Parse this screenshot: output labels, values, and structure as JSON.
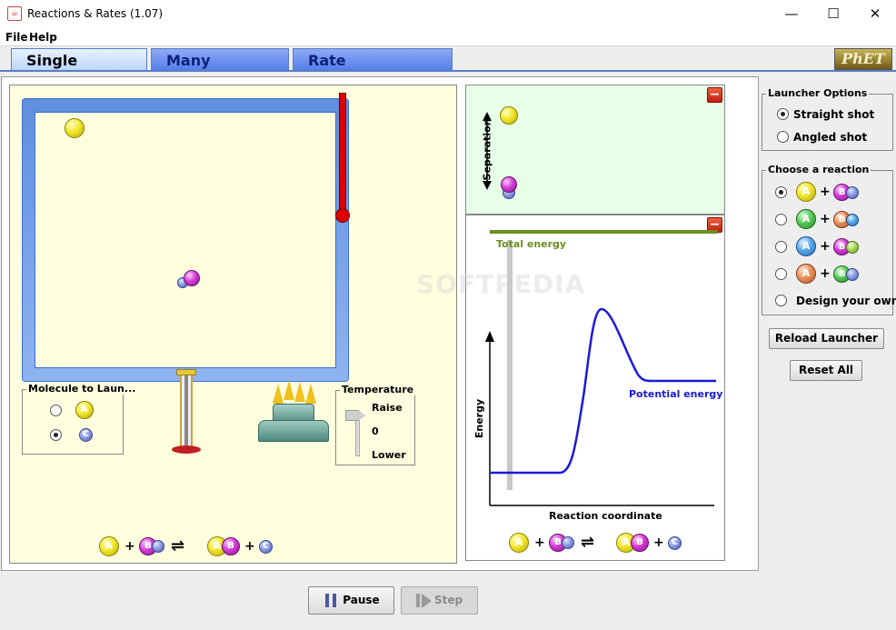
{
  "window": {
    "title": "Reactions & Rates (1.07)",
    "icon": "java-icon"
  },
  "menu": {
    "file": "File",
    "help": "Help"
  },
  "tabs": [
    {
      "label": "Single Collision",
      "active": true
    },
    {
      "label": "Many Collisions",
      "active": false
    },
    {
      "label": "Rate Experiments",
      "active": false
    }
  ],
  "logo": "PhET",
  "watermark": "SOFTPEDIA",
  "launcher_molecule": {
    "title": "Molecule to Laun...",
    "options": [
      {
        "letter": "A",
        "selected": false
      },
      {
        "letter": "C",
        "selected": true
      }
    ]
  },
  "temperature": {
    "title": "Temperature",
    "raise": "Raise",
    "zero": "0",
    "lower": "Lower"
  },
  "equation": {
    "r1": "A",
    "plus": "+",
    "r2": "B",
    "arrows": "⇌",
    "p1a": "A",
    "p1b": "B",
    "p2": "C"
  },
  "separation_label": "Separation",
  "energy_chart": {
    "total_energy_label": "Total energy",
    "potential_energy_label": "Potential energy",
    "ylabel": "Energy",
    "xlabel": "Reaction coordinate"
  },
  "launcher_options": {
    "title": "Launcher Options",
    "options": [
      {
        "label": "Straight shot",
        "selected": true
      },
      {
        "label": "Angled shot",
        "selected": false
      }
    ]
  },
  "choose_reaction": {
    "title": "Choose a reaction",
    "design_your_own": "Design your own",
    "selected_index": 0
  },
  "buttons": {
    "reload": "Reload Launcher",
    "reset": "Reset All",
    "pause": "Pause",
    "step": "Step"
  },
  "colors": {
    "tab_active": "#b9d4f8",
    "tab_inactive": "#4f7be8",
    "sim_bg": "#ffffe0",
    "chart_green": "#6b8e23",
    "potential_blue": "#1a1ad8"
  }
}
